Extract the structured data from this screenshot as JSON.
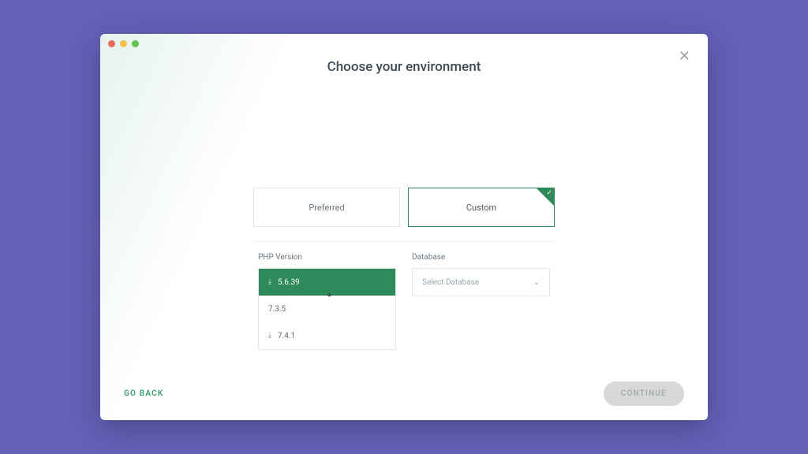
{
  "header": {
    "title": "Choose your environment"
  },
  "tabs": {
    "preferred": "Preferred",
    "custom": "Custom"
  },
  "php": {
    "label": "PHP Version",
    "options": [
      {
        "label": "5.6.39",
        "download": true
      },
      {
        "label": "7.3.5",
        "download": false
      },
      {
        "label": "7.4.1",
        "download": true
      }
    ]
  },
  "database": {
    "label": "Database",
    "placeholder": "Select Database"
  },
  "footer": {
    "back": "GO BACK",
    "continue": "CONTINUE"
  }
}
